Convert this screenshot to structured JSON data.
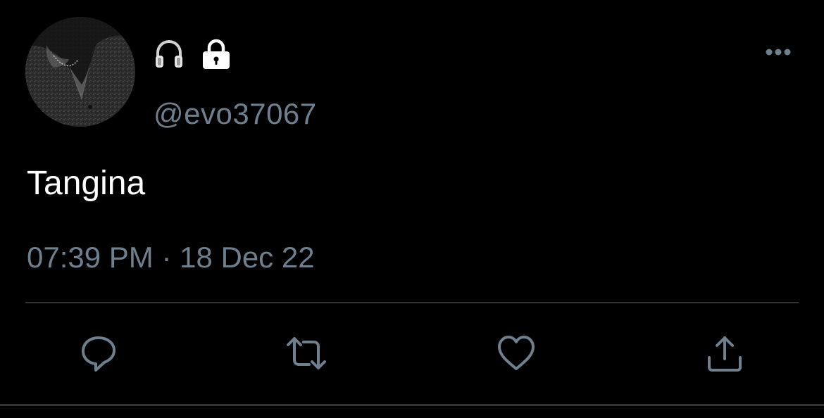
{
  "tweet": {
    "handle": "@evo37067",
    "text": "Tangina",
    "time": "07:39 PM",
    "separator": " · ",
    "date": "18 Dec 22",
    "name_icons": [
      "headphones-icon",
      "lock-icon"
    ]
  },
  "actions": [
    "reply-icon",
    "retweet-icon",
    "like-icon",
    "share-icon"
  ],
  "colors": {
    "background": "#000000",
    "text": "#ffffff",
    "secondary": "#6e7f8e",
    "divider": "#2f3336"
  }
}
